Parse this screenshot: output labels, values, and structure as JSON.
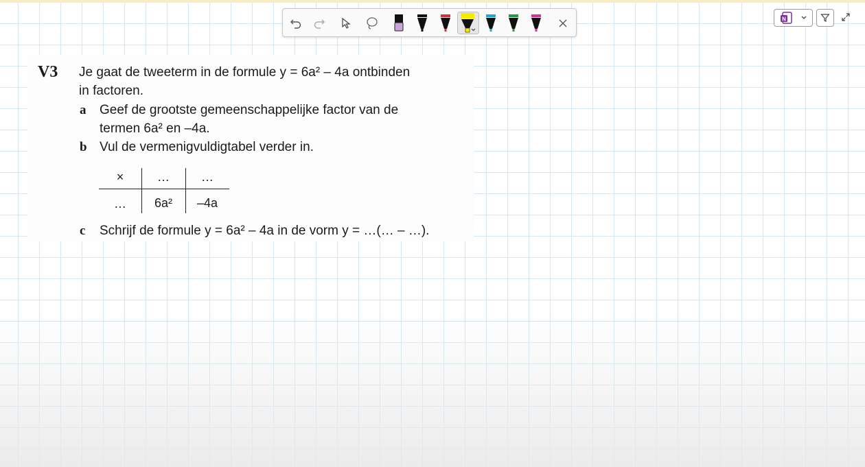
{
  "toolbar": {
    "tools": [
      {
        "name": "undo"
      },
      {
        "name": "redo"
      },
      {
        "name": "select"
      },
      {
        "name": "lasso"
      },
      {
        "name": "eraser",
        "color": "#caa6d8"
      },
      {
        "name": "pen-black",
        "color": "#111111"
      },
      {
        "name": "pen-red",
        "color": "#e0283a"
      },
      {
        "name": "highlighter-yellow",
        "color": "#f5ec00",
        "selected": true
      },
      {
        "name": "pen-blue",
        "color": "#1fa6d8"
      },
      {
        "name": "pen-green",
        "color": "#1f9a4a"
      },
      {
        "name": "pen-magenta",
        "color": "#d62f9a"
      },
      {
        "name": "close"
      }
    ]
  },
  "controls": {
    "onenote_badge": "N",
    "filter": "filter",
    "expand": "expand"
  },
  "exercise": {
    "number": "V3",
    "intro_line1": "Je gaat de tweeterm in de formule y = 6a² – 4a ontbinden",
    "intro_line2": "in factoren.",
    "a_letter": "a",
    "a_line1": "Geef de grootste gemeenschappelijke factor van de",
    "a_line2": "termen 6a² en –4a.",
    "b_letter": "b",
    "b_line": "Vul de vermenigvuldigtabel verder in.",
    "table": {
      "corner": "×",
      "col1": "…",
      "col2": "…",
      "row1": "…",
      "cell1": "6a²",
      "cell2": "–4a"
    },
    "c_letter": "c",
    "c_line": "Schrijf de formule y = 6a² – 4a in de vorm y = …(… – …)."
  }
}
